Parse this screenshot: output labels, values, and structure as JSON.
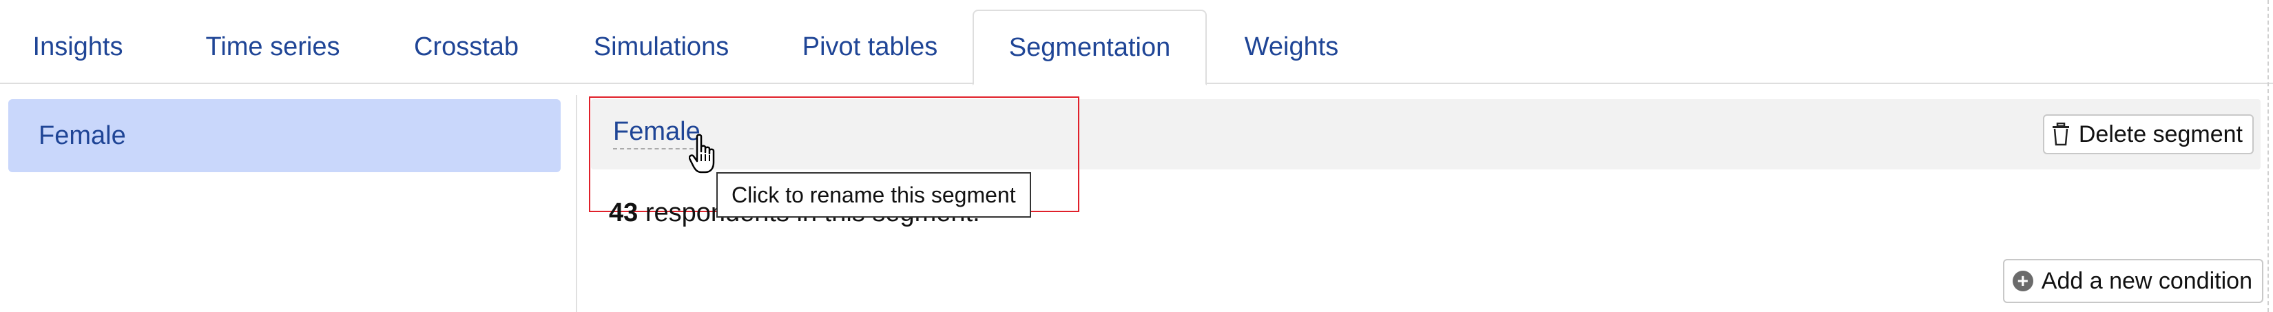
{
  "tabs": [
    {
      "label": "Insights",
      "active": false
    },
    {
      "label": "Time series",
      "active": false
    },
    {
      "label": "Crosstab",
      "active": false
    },
    {
      "label": "Simulations",
      "active": false
    },
    {
      "label": "Pivot tables",
      "active": false
    },
    {
      "label": "Segmentation",
      "active": true
    },
    {
      "label": "Weights",
      "active": false
    }
  ],
  "segment_list": {
    "items": [
      {
        "label": "Female",
        "selected": true
      }
    ]
  },
  "segment_detail": {
    "name": "Female",
    "rename_tooltip": "Click to rename this segment",
    "delete_label": "Delete segment",
    "respondent_count": "43",
    "respondent_suffix": "respondents in this segment.",
    "add_condition_label": "Add a new condition"
  },
  "icons": {
    "delete": "trash-icon",
    "add": "plus-circle-icon",
    "cursor": "hand-pointer-icon"
  },
  "colors": {
    "link_blue": "#1f4596",
    "selected_bg": "#c9d7fb",
    "header_bg": "#f2f2f2",
    "highlight_red": "#e0202a"
  }
}
